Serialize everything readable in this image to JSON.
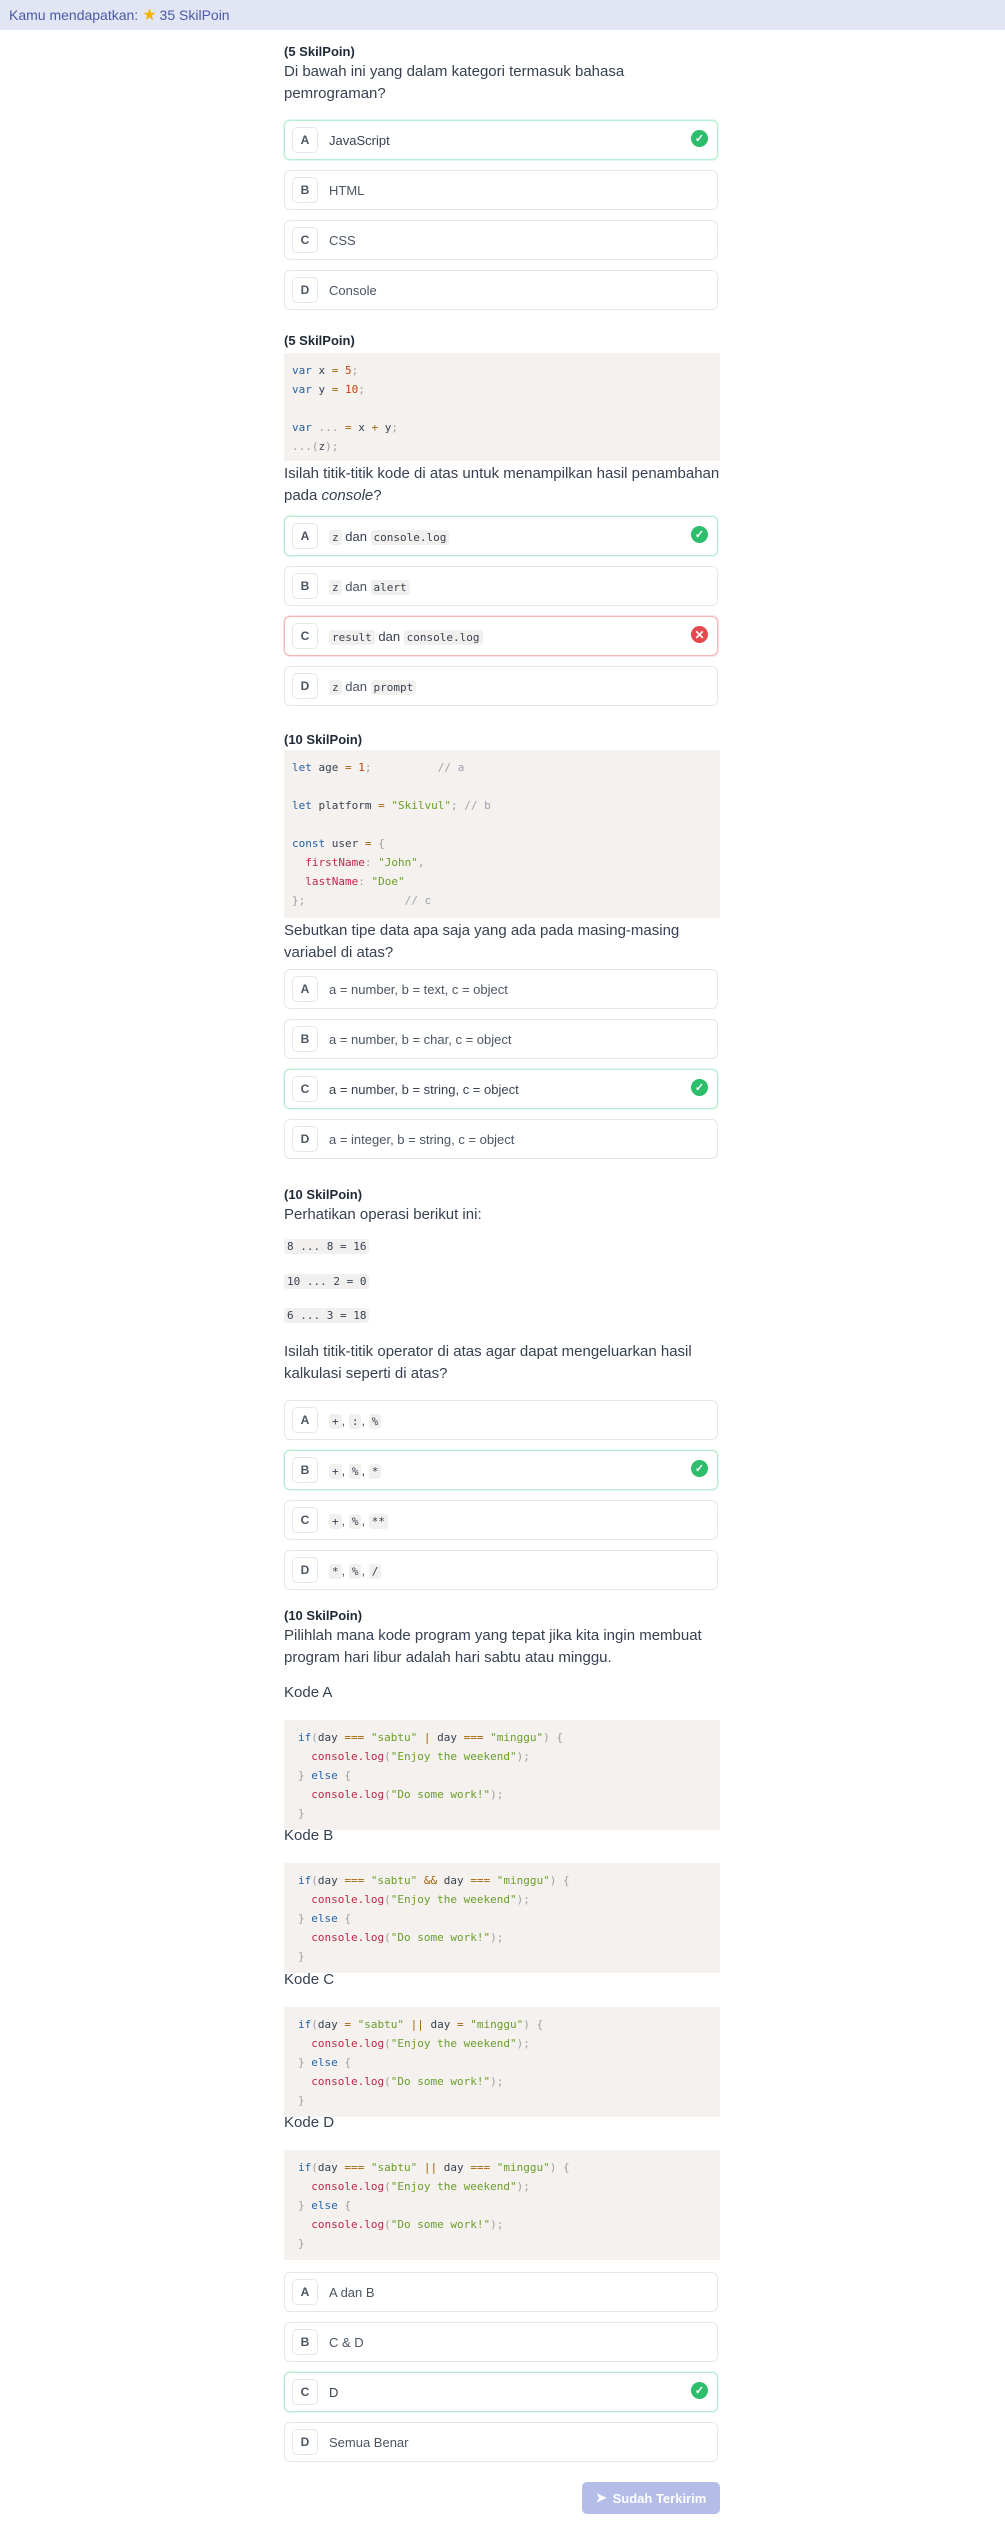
{
  "topbar": {
    "prefix": "Kamu mendapatkan:",
    "points": "35 SkilPoin",
    "star_icon": "star-icon"
  },
  "q1": {
    "points": "(5 SkilPoin)",
    "text": "Di bawah ini yang dalam kategori termasuk bahasa pemrograman?",
    "options": [
      {
        "letter": "A",
        "text": "JavaScript",
        "state": "correct"
      },
      {
        "letter": "B",
        "text": "HTML",
        "state": ""
      },
      {
        "letter": "C",
        "text": "CSS",
        "state": ""
      },
      {
        "letter": "D",
        "text": "Console",
        "state": ""
      }
    ]
  },
  "q2": {
    "points": "(5 SkilPoin)",
    "code": [
      "var x = 5;",
      "var y = 10;",
      "",
      "var ... = x + y;",
      "...(z);"
    ],
    "text_a": "Isilah titik-titik kode di atas untuk menampilkan hasil penambahan pada ",
    "text_em": "console",
    "text_b": "?",
    "options": [
      {
        "letter": "A",
        "c1": "z",
        "mid": "dan",
        "c2": "console.log",
        "state": "correct"
      },
      {
        "letter": "B",
        "c1": "z",
        "mid": "dan",
        "c2": "alert",
        "state": ""
      },
      {
        "letter": "C",
        "c1": "result",
        "mid": "dan",
        "c2": "console.log",
        "state": "wrong"
      },
      {
        "letter": "D",
        "c1": "z",
        "mid": "dan",
        "c2": "prompt",
        "state": ""
      }
    ]
  },
  "q3": {
    "points": "(10 SkilPoin)",
    "code": [
      "let age = 1;          // a",
      "",
      "let platform = \"Skilvul\"; // b",
      "",
      "const user = {",
      "  firstName: \"John\",",
      "  lastName: \"Doe\"",
      "};               // c"
    ],
    "text": "Sebutkan tipe data apa saja yang ada pada masing-masing variabel di atas?",
    "options": [
      {
        "letter": "A",
        "text": "a = number, b = text, c = object",
        "state": ""
      },
      {
        "letter": "B",
        "text": "a = number, b = char, c = object",
        "state": ""
      },
      {
        "letter": "C",
        "text": "a = number, b = string, c = object",
        "state": "correct"
      },
      {
        "letter": "D",
        "text": "a = integer, b = string, c = object",
        "state": ""
      }
    ]
  },
  "q4": {
    "points": "(10 SkilPoin)",
    "intro": "Perhatikan operasi berikut ini:",
    "ops": [
      "8 ... 8 = 16",
      "10 ... 2 = 0",
      "6 ... 3 = 18"
    ],
    "text": "Isilah titik-titik operator di atas agar dapat mengeluarkan hasil kalkulasi seperti di atas?",
    "options": [
      {
        "letter": "A",
        "codes": [
          "+",
          ":",
          "%"
        ],
        "state": ""
      },
      {
        "letter": "B",
        "codes": [
          "+",
          "%",
          "*"
        ],
        "state": "correct"
      },
      {
        "letter": "C",
        "codes": [
          "+",
          "%",
          "**"
        ],
        "state": ""
      },
      {
        "letter": "D",
        "codes": [
          "*",
          "%",
          "/"
        ],
        "state": ""
      }
    ]
  },
  "q5": {
    "points": "(10 SkilPoin)",
    "text": "Pilihlah mana kode program yang tepat jika kita ingin membuat program hari libur adalah hari sabtu atau minggu.",
    "blocks": [
      {
        "label": "Kode A",
        "cond_op1": "===",
        "logic": "|",
        "cond_op2": "==="
      },
      {
        "label": "Kode B",
        "cond_op1": "===",
        "logic": "&&",
        "cond_op2": "==="
      },
      {
        "label": "Kode C",
        "cond_op1": "=",
        "logic": "||",
        "cond_op2": "="
      },
      {
        "label": "Kode D",
        "cond_op1": "===",
        "logic": "||",
        "cond_op2": "==="
      }
    ],
    "code_parts": {
      "if": "if",
      "var": "day",
      "v1": "\"sabtu\"",
      "v2": "\"minggu\"",
      "log1": "console.log(\"Enjoy the weekend\");",
      "else": "else",
      "log2": "console.log(\"Do some work!\");"
    },
    "options": [
      {
        "letter": "A",
        "text": "A dan B",
        "state": ""
      },
      {
        "letter": "B",
        "text": "C & D",
        "state": ""
      },
      {
        "letter": "C",
        "text": "D",
        "state": "correct"
      },
      {
        "letter": "D",
        "text": "Semua Benar",
        "state": ""
      }
    ]
  },
  "submit": {
    "label": "Sudah Terkirim",
    "icon": "paper-plane-icon"
  }
}
